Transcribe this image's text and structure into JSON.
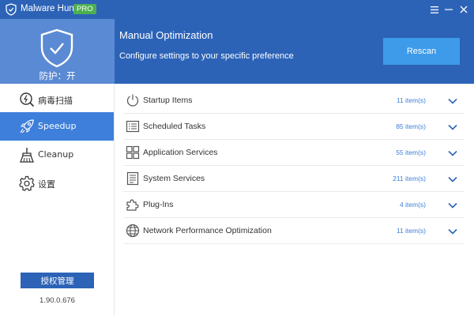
{
  "titlebar": {
    "app_title": "Malware Hunter",
    "pro_badge": "PRO"
  },
  "shield_panel": {
    "status": "防护：开"
  },
  "header": {
    "title": "Manual Optimization",
    "subtitle": "Configure settings to your specific preference",
    "rescan_label": "Rescan"
  },
  "sidebar": {
    "items": [
      {
        "label": "病毒扫描",
        "icon": "scan-icon",
        "active": false
      },
      {
        "label": "Speedup",
        "icon": "rocket-icon",
        "active": true
      },
      {
        "label": "Cleanup",
        "icon": "broom-icon",
        "active": false
      },
      {
        "label": "设置",
        "icon": "gear-icon",
        "active": false
      }
    ],
    "license_label": "授权管理",
    "version": "1.90.0.676"
  },
  "rows": [
    {
      "label": "Startup Items",
      "count": "11 item(s)",
      "icon": "power-icon"
    },
    {
      "label": "Scheduled Tasks",
      "count": "85 item(s)",
      "icon": "list-icon"
    },
    {
      "label": "Application Services",
      "count": "55 item(s)",
      "icon": "grid-icon"
    },
    {
      "label": "System Services",
      "count": "211 item(s)",
      "icon": "document-icon"
    },
    {
      "label": "Plug-Ins",
      "count": "4 item(s)",
      "icon": "puzzle-icon"
    },
    {
      "label": "Network Performance Optimization",
      "count": "11 item(s)",
      "icon": "globe-icon"
    }
  ],
  "colors": {
    "header_blue": "#2c63b7",
    "shield_panel_blue": "#5b8ad4",
    "active_nav_blue": "#3d7fdb",
    "rescan_blue": "#3d9be9",
    "pro_green": "#4caf50",
    "count_blue": "#3d7fdb"
  }
}
